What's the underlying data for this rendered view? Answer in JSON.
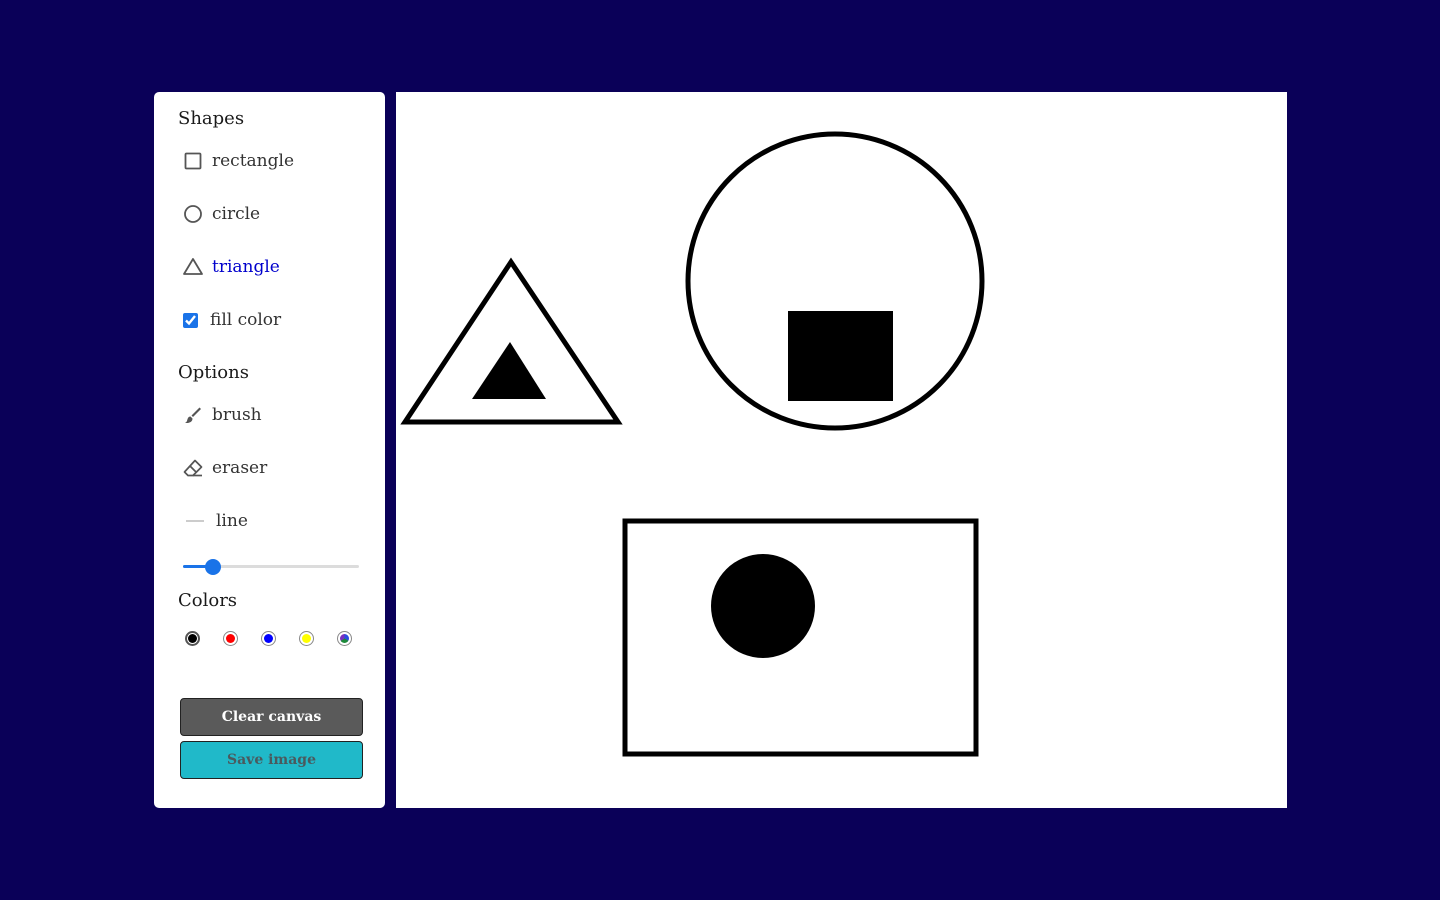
{
  "toolbox": {
    "shapes_title": "Shapes",
    "shapes": [
      {
        "label": "rectangle",
        "icon": "square-outline-icon",
        "active": false
      },
      {
        "label": "circle",
        "icon": "circle-outline-icon",
        "active": false
      },
      {
        "label": "triangle",
        "icon": "triangle-outline-icon",
        "active": true
      }
    ],
    "fill_color": {
      "label": "fill color",
      "checked": true
    },
    "options_title": "Options",
    "options": [
      {
        "label": "brush",
        "icon": "brush-icon"
      },
      {
        "label": "eraser",
        "icon": "eraser-icon"
      },
      {
        "label": "line",
        "icon": "line-icon"
      }
    ],
    "size_slider": {
      "value_fraction": 0.17
    },
    "colors_title": "Colors",
    "colors": [
      {
        "hex": "#000000",
        "selected": true
      },
      {
        "hex": "#ff0000",
        "selected": false
      },
      {
        "hex": "#0000ff",
        "selected": false
      },
      {
        "hex": "#ffff00",
        "selected": false
      },
      {
        "hex": "custom-picker",
        "selected": false
      }
    ],
    "clear_label": "Clear canvas",
    "save_label": "Save image"
  },
  "theme": {
    "background": "#0a0058",
    "accent": "#1a73e8",
    "active_text": "#0000cc",
    "clear_button": "#5a5a5a",
    "save_button": "#20b9c9"
  }
}
